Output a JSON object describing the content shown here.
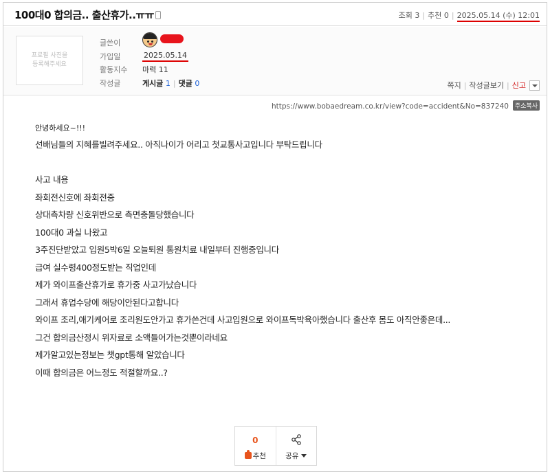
{
  "post": {
    "title": "100대0 합의금.. 출산휴가..ㅠㅠ",
    "views_label": "조회 3",
    "recommend_label": "추천 0",
    "datetime": "2025.05.14 (수) 12:01"
  },
  "profile": {
    "photo_placeholder": "프로필 사진을\n등록해주세요",
    "writer_label": "글쓴이",
    "joined_label": "가입일",
    "joined_value": "2025.05.14",
    "activity_label": "활동지수",
    "activity_value": "마력 11",
    "posts_label": "작성글",
    "posts_text": "게시글",
    "posts_count": "1",
    "comments_text": "댓글",
    "comments_count": "0"
  },
  "actions": {
    "message": "쪽지",
    "view_posts": "작성글보기",
    "report": "신고"
  },
  "url": {
    "text": "https://www.bobaedream.co.kr/view?code=accident&No=837240",
    "copy_label": "주소복사"
  },
  "body": {
    "greeting": "안녕하세요~!!!",
    "lines": [
      "선배님들의 지혜를빌려주세요.. 아직나이가 어리고 첫교통사고입니다 부탁드립니다",
      "",
      "사고 내용",
      "좌회전신호에 좌회전중",
      "상대측차량 신호위반으로 측면충돌당했습니다",
      "100대0 과실 나왔고",
      "3주진단받았고 입원5박6일 오늘퇴원 통원치료 내일부터 진행중입니다",
      "급여 실수령400정도받는 직업인데",
      "제가 와이프출산휴가로 휴가중 사고가났습니다",
      "그래서 휴업수당에 해당이안된다고합니다",
      "와이프 조리,애기케어로 조리원도안가고 휴가쓴건데 사고입원으로 와이프독박육아했습니다 출산후 몸도 아직안좋은데...",
      "그건 합의금산정시 위자료로 소액들어가는것뿐이라네요",
      "제가알고있는정보는 챗gpt통해 알았습니다",
      "이때 합의금은 어느정도 적절할까요..?"
    ]
  },
  "vote": {
    "count": "0",
    "recommend_label": "추천",
    "share_label": "공유"
  },
  "colors": {
    "accent_red": "#d00000",
    "recommend_orange": "#e8541c",
    "link_blue": "#1b5fd6"
  }
}
